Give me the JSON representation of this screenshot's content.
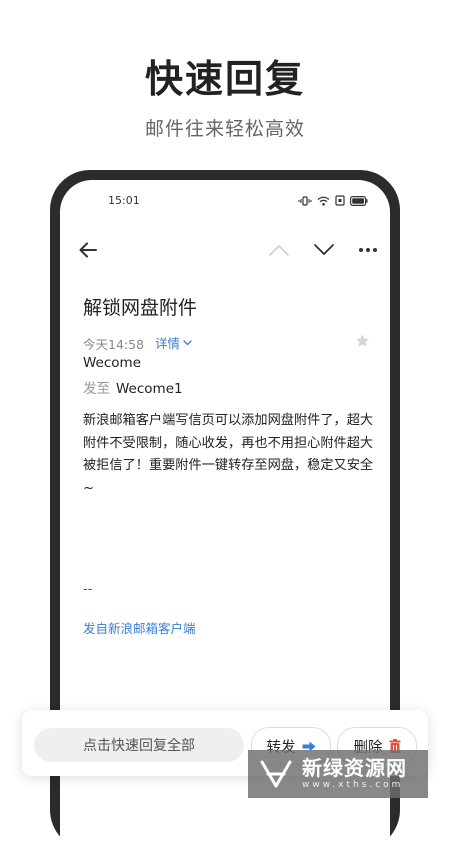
{
  "promo": {
    "headline": "快速回复",
    "subline": "邮件往来轻松高效"
  },
  "status_bar": {
    "time": "15:01",
    "icons": [
      "vibrate-icon",
      "wifi-icon",
      "sim-icon",
      "battery-icon"
    ]
  },
  "nav": {
    "icons": [
      "back-arrow-icon",
      "chevron-up-icon",
      "chevron-down-icon",
      "more-icon"
    ]
  },
  "email": {
    "subject": "解锁网盘附件",
    "time": "今天14:58",
    "detail_link": "详情",
    "sender": "Wecome",
    "to_label": "发至",
    "to_value": "Wecome1",
    "body_lines": [
      "新浪邮箱客户端写信页可以添加网盘附件了，超大",
      "附件不受限制，随心收发，再也不用担心附件超大",
      "被拒信了！重要附件一键转存至网盘，稳定又安全",
      "~"
    ],
    "signature_dash": "--",
    "signature_link": "发自新浪邮箱客户端"
  },
  "actions": {
    "quick_reply": "点击快速回复全部",
    "forward": "转发",
    "delete": "删除"
  },
  "watermark": {
    "main": "新绿资源网",
    "sub": "www.xths.com"
  },
  "colors": {
    "accent_blue": "#3a7ed6",
    "delete_red": "#e0533f",
    "phone_frame": "#2b2b2b"
  }
}
